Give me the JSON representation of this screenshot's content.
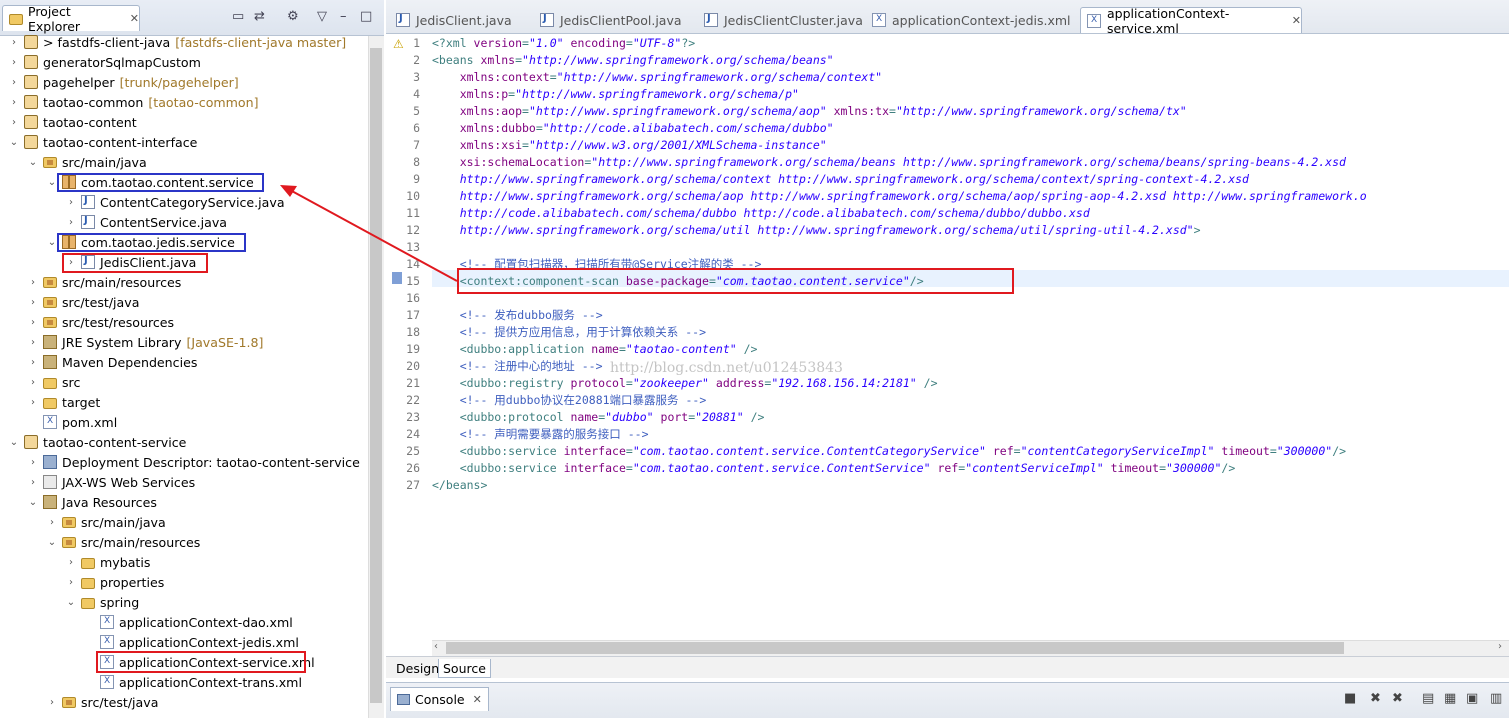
{
  "explorer": {
    "title": "Project Explorer"
  },
  "tree": [
    {
      "label": "> fastdfs-client-java",
      "deco": "[fastdfs-client-java master]",
      "icon": "project-icon",
      "arrow": "›"
    },
    {
      "label": "generatorSqlmapCustom",
      "deco": "",
      "icon": "project-icon",
      "arrow": "›"
    },
    {
      "label": "pagehelper",
      "deco": "[trunk/pagehelper]",
      "icon": "project-icon",
      "arrow": "›"
    },
    {
      "label": "taotao-common",
      "deco": "[taotao-common]",
      "icon": "project-icon",
      "arrow": "›"
    },
    {
      "label": "taotao-content",
      "deco": "",
      "icon": "project-icon",
      "arrow": "›"
    },
    {
      "label": "taotao-content-interface",
      "deco": "",
      "icon": "project-icon",
      "arrow": "⌄"
    },
    {
      "label": "src/main/java",
      "deco": "",
      "icon": "source-folder-icon",
      "arrow": "⌄"
    },
    {
      "label": "com.taotao.content.service",
      "deco": "",
      "icon": "package-icon",
      "arrow": "⌄"
    },
    {
      "label": "ContentCategoryService.java",
      "deco": "",
      "icon": "java-file-icon",
      "arrow": "›"
    },
    {
      "label": "ContentService.java",
      "deco": "",
      "icon": "java-file-icon",
      "arrow": "›"
    },
    {
      "label": "com.taotao.jedis.service",
      "deco": "",
      "icon": "package-icon",
      "arrow": "⌄"
    },
    {
      "label": "JedisClient.java",
      "deco": "",
      "icon": "java-file-icon",
      "arrow": "›"
    },
    {
      "label": "src/main/resources",
      "deco": "",
      "icon": "source-folder-icon",
      "arrow": "›"
    },
    {
      "label": "src/test/java",
      "deco": "",
      "icon": "source-folder-icon",
      "arrow": "›"
    },
    {
      "label": "src/test/resources",
      "deco": "",
      "icon": "source-folder-icon",
      "arrow": "›"
    },
    {
      "label": "JRE System Library",
      "deco": "[JavaSE-1.8]",
      "icon": "library-icon",
      "arrow": "›"
    },
    {
      "label": "Maven Dependencies",
      "deco": "",
      "icon": "library-icon",
      "arrow": "›"
    },
    {
      "label": "src",
      "deco": "",
      "icon": "folder-icon",
      "arrow": "›"
    },
    {
      "label": "target",
      "deco": "",
      "icon": "folder-icon",
      "arrow": "›"
    },
    {
      "label": "pom.xml",
      "deco": "",
      "icon": "xml-file-icon",
      "arrow": ""
    },
    {
      "label": "taotao-content-service",
      "deco": "",
      "icon": "project-icon",
      "arrow": "⌄"
    },
    {
      "label": "Deployment Descriptor: taotao-content-service",
      "deco": "",
      "icon": "deployment-descriptor-icon",
      "arrow": "›"
    },
    {
      "label": "JAX-WS Web Services",
      "deco": "",
      "icon": "web-services-icon",
      "arrow": "›"
    },
    {
      "label": "Java Resources",
      "deco": "",
      "icon": "library-icon",
      "arrow": "⌄"
    },
    {
      "label": "src/main/java",
      "deco": "",
      "icon": "source-folder-icon",
      "arrow": "›"
    },
    {
      "label": "src/main/resources",
      "deco": "",
      "icon": "source-folder-icon",
      "arrow": "⌄"
    },
    {
      "label": "mybatis",
      "deco": "",
      "icon": "folder-icon",
      "arrow": "›"
    },
    {
      "label": "properties",
      "deco": "",
      "icon": "folder-icon",
      "arrow": "›"
    },
    {
      "label": "spring",
      "deco": "",
      "icon": "folder-icon",
      "arrow": "⌄"
    },
    {
      "label": "applicationContext-dao.xml",
      "deco": "",
      "icon": "xml-file-icon",
      "arrow": ""
    },
    {
      "label": "applicationContext-jedis.xml",
      "deco": "",
      "icon": "xml-file-icon",
      "arrow": ""
    },
    {
      "label": "applicationContext-service.xml",
      "deco": "",
      "icon": "xml-file-icon",
      "arrow": ""
    },
    {
      "label": "applicationContext-trans.xml",
      "deco": "",
      "icon": "xml-file-icon",
      "arrow": ""
    },
    {
      "label": "src/test/java",
      "deco": "",
      "icon": "source-folder-icon",
      "arrow": "›"
    }
  ],
  "editor_tabs": [
    {
      "label": "JedisClient.java",
      "icon": "java-file-icon"
    },
    {
      "label": "JedisClientPool.java",
      "icon": "java-file-icon"
    },
    {
      "label": "JedisClientCluster.java",
      "icon": "java-file-icon"
    },
    {
      "label": "applicationContext-jedis.xml",
      "icon": "xml-file-icon"
    },
    {
      "label": "applicationContext-service.xml",
      "icon": "xml-file-icon",
      "active": true
    }
  ],
  "line_numbers": [
    "1",
    "2",
    "3",
    "4",
    "5",
    "6",
    "7",
    "8",
    "9",
    "10",
    "11",
    "12",
    "13",
    "14",
    "15",
    "16",
    "17",
    "18",
    "19",
    "20",
    "21",
    "22",
    "23",
    "24",
    "25",
    "26",
    "27"
  ],
  "code_lines": [
    [
      [
        "pi",
        "<?xml "
      ],
      [
        "an",
        "version"
      ],
      [
        "tg",
        "="
      ],
      [
        "av",
        "\"1.0\""
      ],
      [
        "tg",
        " "
      ],
      [
        "an",
        "encoding"
      ],
      [
        "tg",
        "="
      ],
      [
        "av",
        "\"UTF-8\""
      ],
      [
        "pi",
        "?>"
      ]
    ],
    [
      [
        "tg",
        "<beans "
      ],
      [
        "an",
        "xmlns"
      ],
      [
        "tg",
        "="
      ],
      [
        "av",
        "\"http://www.springframework.org/schema/beans\""
      ]
    ],
    [
      [
        "an",
        "    xmlns:context"
      ],
      [
        "tg",
        "="
      ],
      [
        "av",
        "\"http://www.springframework.org/schema/context\""
      ]
    ],
    [
      [
        "an",
        "    xmlns:p"
      ],
      [
        "tg",
        "="
      ],
      [
        "av",
        "\"http://www.springframework.org/schema/p\""
      ]
    ],
    [
      [
        "an",
        "    xmlns:aop"
      ],
      [
        "tg",
        "="
      ],
      [
        "av",
        "\"http://www.springframework.org/schema/aop\""
      ],
      [
        "tg",
        " "
      ],
      [
        "an",
        "xmlns:tx"
      ],
      [
        "tg",
        "="
      ],
      [
        "av",
        "\"http://www.springframework.org/schema/tx\""
      ]
    ],
    [
      [
        "an",
        "    xmlns:dubbo"
      ],
      [
        "tg",
        "="
      ],
      [
        "av",
        "\"http://code.alibabatech.com/schema/dubbo\""
      ]
    ],
    [
      [
        "an",
        "    xmlns:xsi"
      ],
      [
        "tg",
        "="
      ],
      [
        "av",
        "\"http://www.w3.org/2001/XMLSchema-instance\""
      ]
    ],
    [
      [
        "an",
        "    xsi:schemaLocation"
      ],
      [
        "tg",
        "="
      ],
      [
        "av",
        "\"http://www.springframework.org/schema/beans http://www.springframework.org/schema/beans/spring-beans-4.2.xsd"
      ]
    ],
    [
      [
        "av",
        "    http://www.springframework.org/schema/context http://www.springframework.org/schema/context/spring-context-4.2.xsd"
      ]
    ],
    [
      [
        "av",
        "    http://www.springframework.org/schema/aop http://www.springframework.org/schema/aop/spring-aop-4.2.xsd http://www.springframework.o"
      ]
    ],
    [
      [
        "av",
        "    http://code.alibabatech.com/schema/dubbo http://code.alibabatech.com/schema/dubbo/dubbo.xsd"
      ]
    ],
    [
      [
        "av",
        "    http://www.springframework.org/schema/util http://www.springframework.org/schema/util/spring-util-4.2.xsd\""
      ],
      [
        "tg",
        ">"
      ]
    ],
    [],
    [
      [
        "cm",
        "    <!-- 配置包扫描器，扫描所有带@Service注解的类 -->"
      ]
    ],
    [
      [
        "tg",
        "    <context:component-scan "
      ],
      [
        "an",
        "base-package"
      ],
      [
        "tg",
        "="
      ],
      [
        "av",
        "\"com.taotao.content.service\""
      ],
      [
        "tg",
        "/>"
      ]
    ],
    [],
    [
      [
        "cm",
        "    <!-- 发布dubbo服务 -->"
      ]
    ],
    [
      [
        "cm",
        "    <!-- 提供方应用信息，用于计算依赖关系 -->"
      ]
    ],
    [
      [
        "tg",
        "    <dubbo:application "
      ],
      [
        "an",
        "name"
      ],
      [
        "tg",
        "="
      ],
      [
        "av",
        "\"taotao-content\""
      ],
      [
        "tg",
        " />"
      ]
    ],
    [
      [
        "cm",
        "    <!-- 注册中心的地址 -->"
      ]
    ],
    [
      [
        "tg",
        "    <dubbo:registry "
      ],
      [
        "an",
        "protocol"
      ],
      [
        "tg",
        "="
      ],
      [
        "av",
        "\"zookeeper\""
      ],
      [
        "tg",
        " "
      ],
      [
        "an",
        "address"
      ],
      [
        "tg",
        "="
      ],
      [
        "av",
        "\"192.168.156.14:2181\""
      ],
      [
        "tg",
        " />"
      ]
    ],
    [
      [
        "cm",
        "    <!-- 用dubbo协议在20881端口暴露服务 -->"
      ]
    ],
    [
      [
        "tg",
        "    <dubbo:protocol "
      ],
      [
        "an",
        "name"
      ],
      [
        "tg",
        "="
      ],
      [
        "av",
        "\"dubbo\""
      ],
      [
        "tg",
        " "
      ],
      [
        "an",
        "port"
      ],
      [
        "tg",
        "="
      ],
      [
        "av",
        "\"20881\""
      ],
      [
        "tg",
        " />"
      ]
    ],
    [
      [
        "cm",
        "    <!-- 声明需要暴露的服务接口 -->"
      ]
    ],
    [
      [
        "tg",
        "    <dubbo:service "
      ],
      [
        "an",
        "interface"
      ],
      [
        "tg",
        "="
      ],
      [
        "av",
        "\"com.taotao.content.service.ContentCategoryService\""
      ],
      [
        "tg",
        " "
      ],
      [
        "an",
        "ref"
      ],
      [
        "tg",
        "="
      ],
      [
        "av",
        "\"contentCategoryServiceImpl\""
      ],
      [
        "tg",
        " "
      ],
      [
        "an",
        "timeout"
      ],
      [
        "tg",
        "="
      ],
      [
        "av",
        "\"300000\""
      ],
      [
        "tg",
        "/>"
      ]
    ],
    [
      [
        "tg",
        "    <dubbo:service "
      ],
      [
        "an",
        "interface"
      ],
      [
        "tg",
        "="
      ],
      [
        "av",
        "\"com.taotao.content.service.ContentService\""
      ],
      [
        "tg",
        " "
      ],
      [
        "an",
        "ref"
      ],
      [
        "tg",
        "="
      ],
      [
        "av",
        "\"contentServiceImpl\""
      ],
      [
        "tg",
        " "
      ],
      [
        "an",
        "timeout"
      ],
      [
        "tg",
        "="
      ],
      [
        "av",
        "\"300000\""
      ],
      [
        "tg",
        "/>"
      ]
    ],
    [
      [
        "tg",
        "</beans>"
      ]
    ]
  ],
  "watermark": "http://blog.csdn.net/u012453843",
  "bottom_tabs": {
    "design": "Design",
    "source": "Source"
  },
  "console": {
    "title": "Console"
  }
}
